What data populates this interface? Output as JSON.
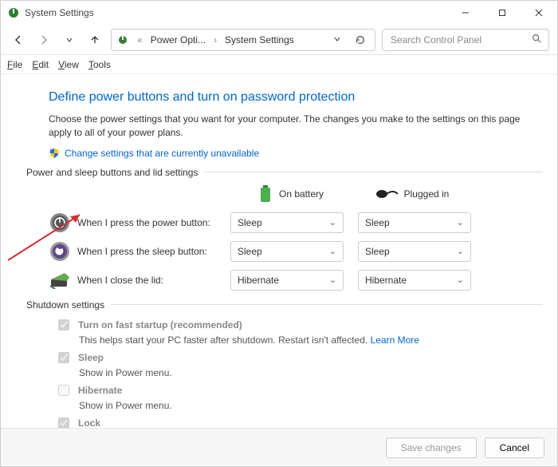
{
  "window": {
    "title": "System Settings"
  },
  "nav": {
    "crumb1": "Power Opti...",
    "crumb2": "System Settings",
    "search_placeholder": "Search Control Panel"
  },
  "menu": {
    "file": "File",
    "edit": "Edit",
    "view": "View",
    "tools": "Tools"
  },
  "page": {
    "heading": "Define power buttons and turn on password protection",
    "desc": "Choose the power settings that you want for your computer. The changes you make to the settings on this page apply to all of your power plans.",
    "change_link": "Change settings that are currently unavailable"
  },
  "section": {
    "buttons_title": "Power and sleep buttons and lid settings",
    "col_battery": "On battery",
    "col_plugged": "Plugged in",
    "rows": [
      {
        "label": "When I press the power button:",
        "battery": "Sleep",
        "plugged": "Sleep"
      },
      {
        "label": "When I press the sleep button:",
        "battery": "Sleep",
        "plugged": "Sleep"
      },
      {
        "label": "When I close the lid:",
        "battery": "Hibernate",
        "plugged": "Hibernate"
      }
    ]
  },
  "shutdown": {
    "title": "Shutdown settings",
    "items": [
      {
        "label": "Turn on fast startup (recommended)",
        "sub": "This helps start your PC faster after shutdown. Restart isn't affected. ",
        "learn": "Learn More",
        "checked": true
      },
      {
        "label": "Sleep",
        "sub": "Show in Power menu.",
        "checked": true
      },
      {
        "label": "Hibernate",
        "sub": "Show in Power menu.",
        "checked": false
      },
      {
        "label": "Lock",
        "sub": "",
        "checked": true
      }
    ]
  },
  "footer": {
    "save": "Save changes",
    "cancel": "Cancel"
  }
}
